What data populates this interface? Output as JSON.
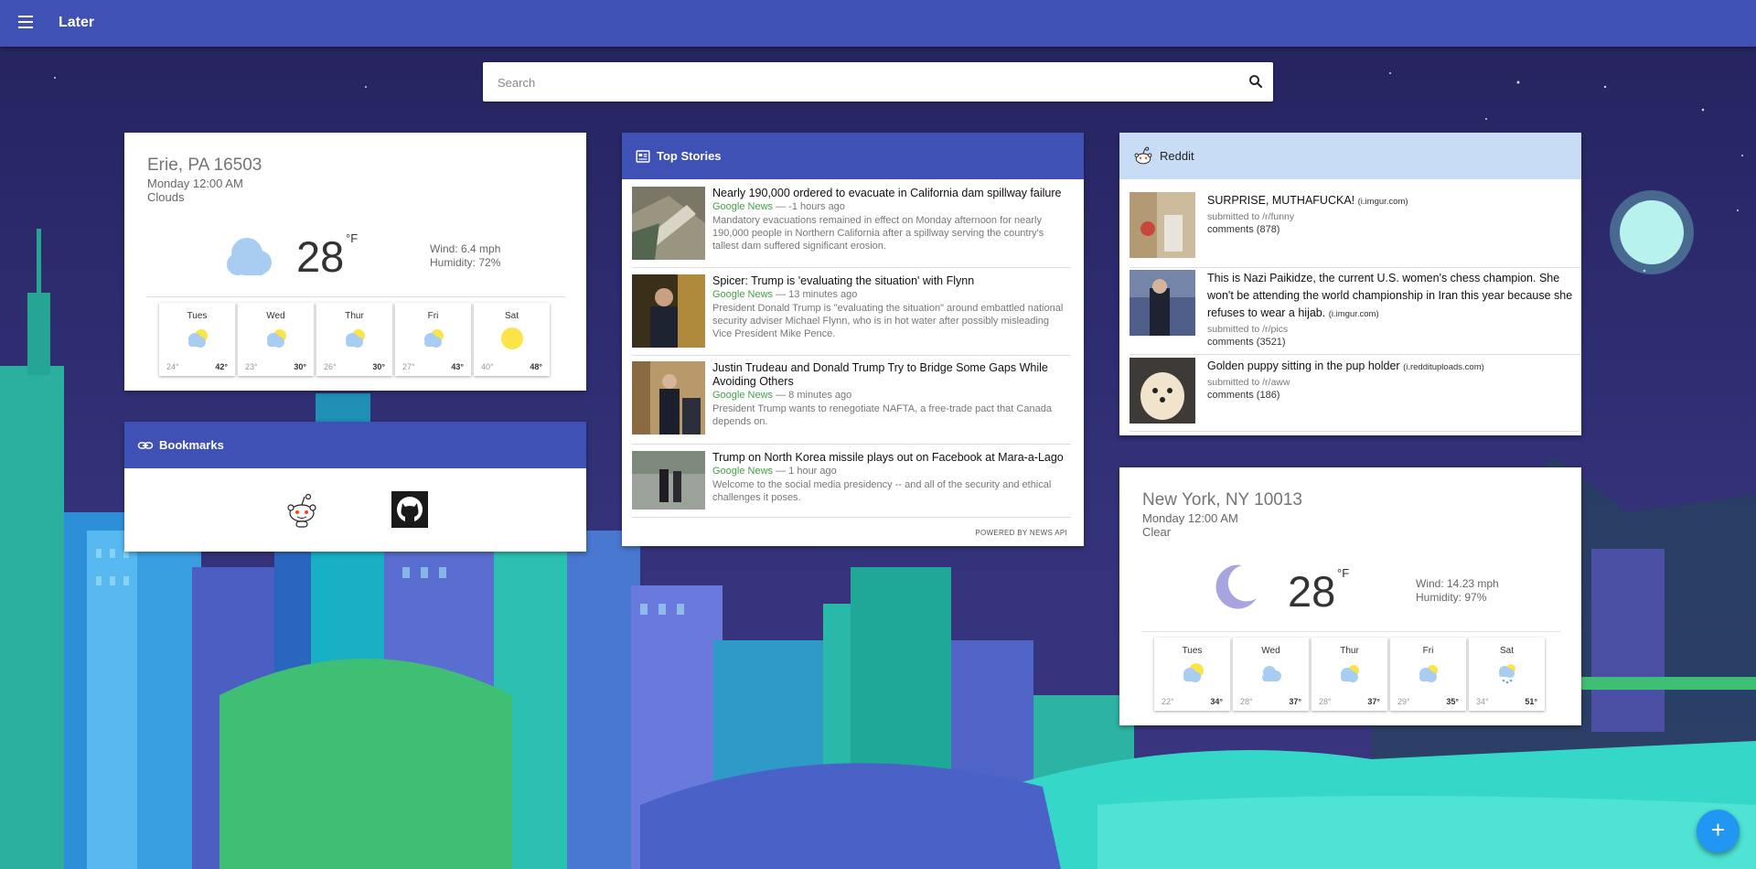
{
  "app": {
    "title": "Later"
  },
  "search": {
    "placeholder": "Search"
  },
  "weather_erie": {
    "location": "Erie, PA 16503",
    "datetime": "Monday 12:00 AM",
    "condition": "Clouds",
    "temp": "28",
    "unit": "°F",
    "wind": "Wind: 6.4 mph",
    "humidity": "Humidity: 72%",
    "icon": "cloud-icon",
    "forecast": [
      {
        "day": "Tues",
        "lo": "24°",
        "hi": "42°",
        "icon": "partly-cloudy-icon"
      },
      {
        "day": "Wed",
        "lo": "23°",
        "hi": "30°",
        "icon": "partly-cloudy-icon"
      },
      {
        "day": "Thur",
        "lo": "26°",
        "hi": "30°",
        "icon": "partly-cloudy-icon"
      },
      {
        "day": "Fri",
        "lo": "27°",
        "hi": "43°",
        "icon": "partly-cloudy-icon"
      },
      {
        "day": "Sat",
        "lo": "40°",
        "hi": "48°",
        "icon": "sun-icon"
      }
    ]
  },
  "bookmarks": {
    "title": "Bookmarks",
    "items": [
      {
        "name": "reddit",
        "icon": "reddit-icon"
      },
      {
        "name": "github",
        "icon": "github-icon"
      }
    ]
  },
  "top_stories": {
    "title": "Top Stories",
    "powered_by": "POWERED BY NEWS API",
    "items": [
      {
        "title": "Nearly 190,000 ordered to evacuate in California dam spillway failure",
        "source": "Google News",
        "time": " — -1 hours ago",
        "description": "Mandatory evacuations remained in effect on Monday afternoon for nearly 190,000 people in Northern California after a spillway serving the country's tallest dam suffered significant erosion."
      },
      {
        "title": "Spicer: Trump is 'evaluating the situation' with Flynn",
        "source": "Google News",
        "time": " — 13 minutes ago",
        "description": "President Donald Trump is \"evaluating the situation\" around embattled national security adviser Michael Flynn, who is in hot water after possibly misleading Vice President Mike Pence."
      },
      {
        "title": "Justin Trudeau and Donald Trump Try to Bridge Some Gaps While Avoiding Others",
        "source": "Google News",
        "time": " — 8 minutes ago",
        "description": "President Trump wants to renegotiate NAFTA, a free-trade pact that Canada depends on."
      },
      {
        "title": "Trump on North Korea missile plays out on Facebook at Mara-a-Lago",
        "source": "Google News",
        "time": " — 1 hour ago",
        "description": "Welcome to the social media presidency -- and all of the security and ethical challenges it poses."
      }
    ]
  },
  "reddit": {
    "title": "Reddit",
    "items": [
      {
        "title": "SURPRISE, MUTHAFUCKA!",
        "domain": "(i.imgur.com)",
        "submitted": "submitted to /r/funny",
        "comments": "comments (878)"
      },
      {
        "title": "This is Nazi Paikidze, the current U.S. women's chess champion. She won't be attending the world championship in Iran this year because she refuses to wear a hijab.",
        "domain": "(i.imgur.com)",
        "submitted": "submitted to /r/pics",
        "comments": "comments (3521)"
      },
      {
        "title": "Golden puppy sitting in the pup holder",
        "domain": "(i.reddituploads.com)",
        "submitted": "submitted to /r/aww",
        "comments": "comments (186)"
      }
    ]
  },
  "weather_ny": {
    "location": "New York, NY 10013",
    "datetime": "Monday 12:00 AM",
    "condition": "Clear",
    "temp": "28",
    "unit": "°F",
    "wind": "Wind: 14.23 mph",
    "humidity": "Humidity: 97%",
    "icon": "moon-icon",
    "forecast": [
      {
        "day": "Tues",
        "lo": "22°",
        "hi": "34°",
        "icon": "partly-cloudy-icon"
      },
      {
        "day": "Wed",
        "lo": "28°",
        "hi": "37°",
        "icon": "cloud-icon"
      },
      {
        "day": "Thur",
        "lo": "28°",
        "hi": "37°",
        "icon": "partly-cloudy-icon"
      },
      {
        "day": "Fri",
        "lo": "29°",
        "hi": "35°",
        "icon": "partly-cloudy-icon"
      },
      {
        "day": "Sat",
        "lo": "34°",
        "hi": "51°",
        "icon": "rain-icon"
      }
    ]
  },
  "fab": {
    "label": "+"
  },
  "colors": {
    "primary": "#3f51b5",
    "reddit_header": "#c8dcf6",
    "fab": "#2196f3",
    "news_source": "#43a047"
  }
}
